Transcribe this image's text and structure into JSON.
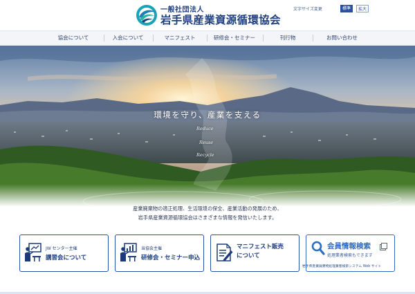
{
  "header": {
    "org_type": "一般社団法人",
    "org_name": "岩手県産業資源循環協会",
    "font_size": {
      "label": "文字サイズ変更",
      "standard": "標準",
      "large": "拡大"
    }
  },
  "nav": [
    {
      "label": "協会について"
    },
    {
      "label": "入会について"
    },
    {
      "label": "マニフェスト"
    },
    {
      "label": "研修会・セミナー"
    },
    {
      "label": "刊行物"
    },
    {
      "label": "お問い合わせ"
    }
  ],
  "hero": {
    "catchcopy": "環境を守り、産業を支える",
    "words": [
      "Reduce",
      "Reuse",
      "Recycle"
    ]
  },
  "intro": {
    "line1": "産業廃棄物の適正処理、生活環境の保全、産業活動の発展のため、",
    "line2": "岩手県産業資源循環協会はさまざまな情報を発信いたします。"
  },
  "cards": [
    {
      "sub": "JW センター主催",
      "title": "講習会について",
      "icon": "lecture-icon"
    },
    {
      "sub": "当協会主催",
      "title": "研修会・セミナー申込",
      "icon": "seminar-icon"
    },
    {
      "line1": "マニフェスト販売",
      "line2": "について",
      "icon": "manifest-icon"
    },
    {
      "title": "会員情報検索",
      "sub": "処理業者検索もできます",
      "caption": "岩手県産業廃棄物処理業者検索システム Web サイト",
      "icon": "search-icon"
    }
  ],
  "colors": {
    "brand": "#1e3f7c",
    "accent": "#2451a4",
    "nav_bg": "#f3f5f8"
  }
}
